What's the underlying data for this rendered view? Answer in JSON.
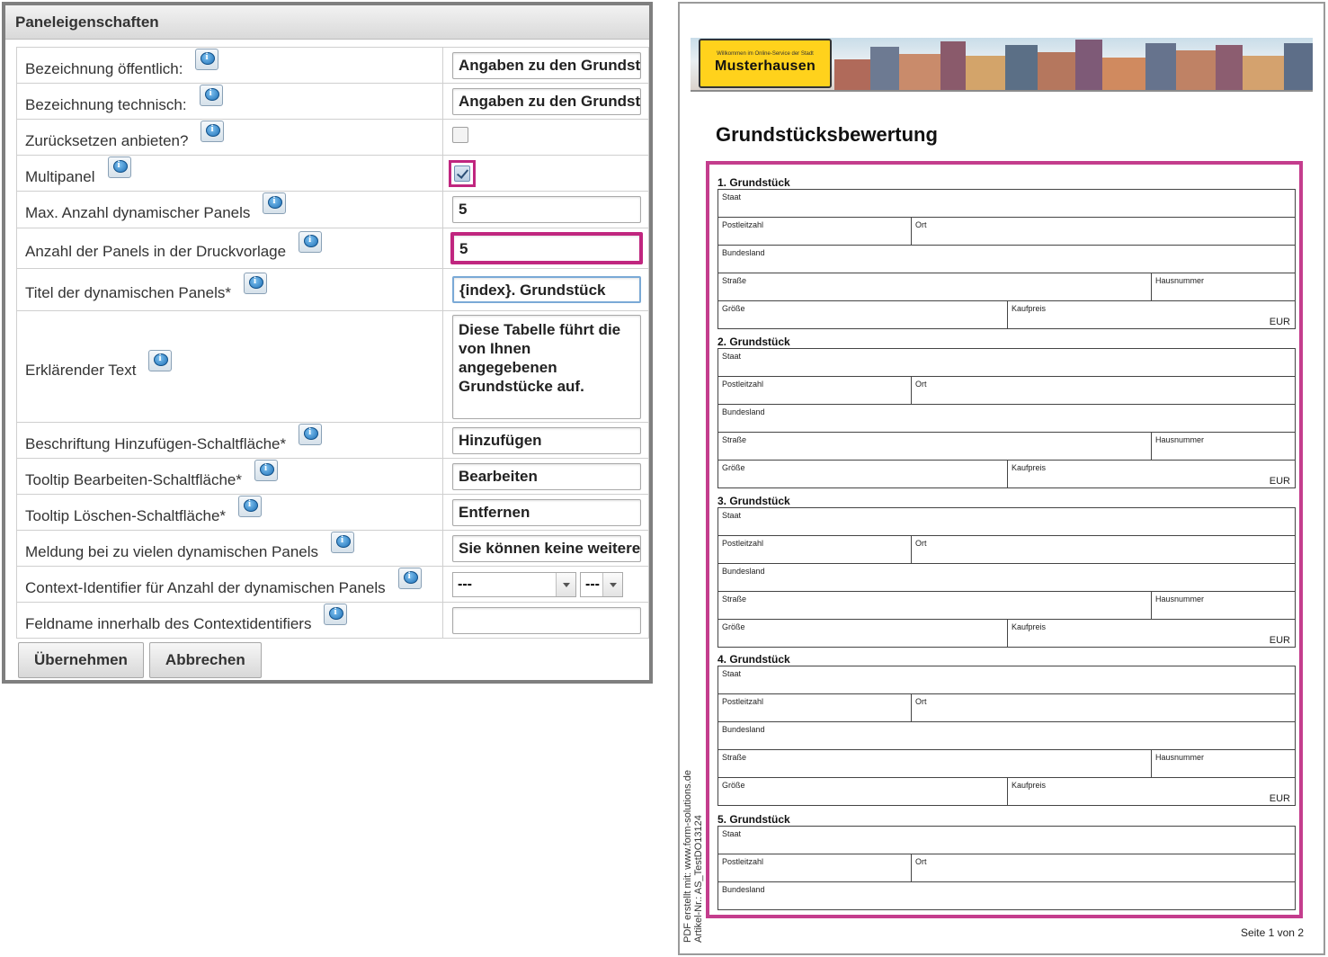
{
  "panel": {
    "title": "Paneleigenschaften",
    "rows": [
      {
        "label": "Bezeichnung öffentlich:",
        "value": "Angaben zu den Grundstücken"
      },
      {
        "label": "Bezeichnung technisch:",
        "value": "Angaben zu den Grundstücken"
      },
      {
        "label": "Zurücksetzen anbieten?",
        "checked": false
      },
      {
        "label": "Multipanel",
        "checked": true
      },
      {
        "label": "Max. Anzahl dynamischer Panels",
        "value": "5"
      },
      {
        "label": "Anzahl der Panels in der Druckvorlage",
        "value": "5"
      },
      {
        "label": "Titel der dynamischen Panels*",
        "value": "{index}. Grundstück"
      },
      {
        "label": "Erklärender Text",
        "value": "Diese Tabelle führt die von Ihnen angegebenen Grundstücke auf."
      },
      {
        "label": "Beschriftung Hinzufügen-Schaltfläche*",
        "value": "Hinzufügen"
      },
      {
        "label": "Tooltip Bearbeiten-Schaltfläche*",
        "value": "Bearbeiten"
      },
      {
        "label": "Tooltip Löschen-Schaltfläche*",
        "value": "Entfernen"
      },
      {
        "label": "Meldung bei zu vielen dynamischen Panels",
        "value": "Sie können keine weiteren"
      },
      {
        "label": "Context-Identifier für Anzahl der dynamischen Panels",
        "select1": "---",
        "select2": "---"
      },
      {
        "label": "Feldname innerhalb des Contextidentifiers",
        "value": ""
      }
    ],
    "buttons": {
      "apply": "Übernehmen",
      "cancel": "Abbrechen"
    }
  },
  "document": {
    "sign_small": "Willkommen im Online-Service der Stadt",
    "sign_town": "Musterhausen",
    "title": "Grundstücksbewertung",
    "sections": [
      {
        "title": "1. Grundstück"
      },
      {
        "title": "2. Grundstück"
      },
      {
        "title": "3. Grundstück"
      },
      {
        "title": "4. Grundstück"
      },
      {
        "title": "5. Grundstück"
      }
    ],
    "fields": {
      "staat": "Staat",
      "plz": "Postleitzahl",
      "ort": "Ort",
      "bundesland": "Bundesland",
      "strasse": "Straße",
      "hausnummer": "Hausnummer",
      "groesse": "Größe",
      "kaufpreis": "Kaufpreis",
      "currency": "EUR"
    },
    "side_line1": "PDF erstellt mit: www.form-solutions.de",
    "side_line2": "Artikel-Nr.: AS_TestDO13124",
    "page_number": "Seite 1 von 2"
  },
  "colors": {
    "highlight": "#c0267f",
    "sign": "#ffd21c"
  }
}
